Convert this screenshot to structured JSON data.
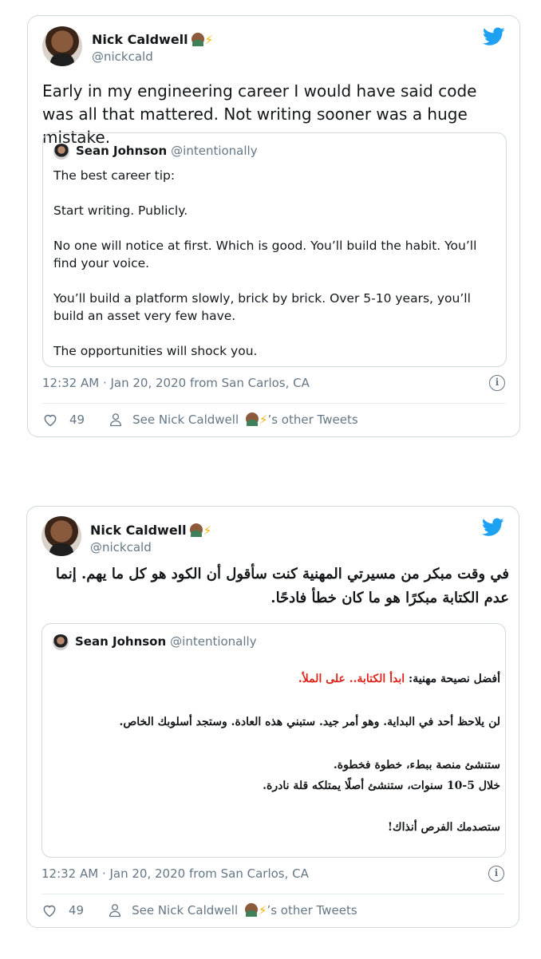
{
  "tweets": [
    {
      "author": {
        "name": "Nick Caldwell",
        "handle": "@nickcald"
      },
      "text": "Early in my engineering career I would have said code was all that mattered. Not writing sooner was a huge mistake.",
      "quoted": {
        "name": "Sean Johnson",
        "handle": "@intentionally",
        "paragraphs": [
          "The best career tip:",
          "Start writing. Publicly.",
          "No one will notice at first. Which is good. You’ll build the habit. You’ll find your voice.",
          "You’ll build a platform slowly, brick by brick. Over 5-10 years, you’ll build an asset very few have.",
          "The opportunities will shock you."
        ]
      },
      "meta": "12:32 AM · Jan 20, 2020 from San Carlos, CA",
      "likes": "49",
      "other_tweets_prefix": "See Nick Caldwell",
      "other_tweets_suffix": "’s other Tweets"
    },
    {
      "author": {
        "name": "Nick Caldwell",
        "handle": "@nickcald"
      },
      "text": "في وقت مبكر من مسيرتي المهنية كنت سأقول أن الكود هو كل ما يهم. إنما عدم الكتابة مبكرًا هو ما كان خطأ فادحًا.",
      "quoted": {
        "name": "Sean Johnson",
        "handle": "@intentionally",
        "line1_prefix": "أفضل نصيحة مهنية: ",
        "line1_highlight": "ابدأ الكتابة.. على الملأ.",
        "line2": "لن يلاحظ أحد في البداية. وهو أمر جيد. ستبني هذه العادة. وستجد أسلوبك الخاص.",
        "line3": "ستنشئ منصة ببطء، خطوة فخطوة.",
        "line4": "خلال 5-10 سنوات، ستنشئ أصلًا يمتلكه قلة نادرة.",
        "line5": "ستصدمك الفرص أنذاك!"
      },
      "meta": "12:32 AM · Jan 20, 2020 from San Carlos, CA",
      "likes": "49",
      "other_tweets_prefix": "See Nick Caldwell",
      "other_tweets_suffix": "’s other Tweets"
    }
  ],
  "colors": {
    "twitter_blue": "#1da1f2",
    "muted": "#657786",
    "border": "#cfd9de",
    "highlight_red": "#d9261c"
  },
  "icons": [
    "twitter-bird-icon",
    "info-icon",
    "heart-icon",
    "user-icon",
    "lightning-emoji",
    "technologist-emoji"
  ]
}
